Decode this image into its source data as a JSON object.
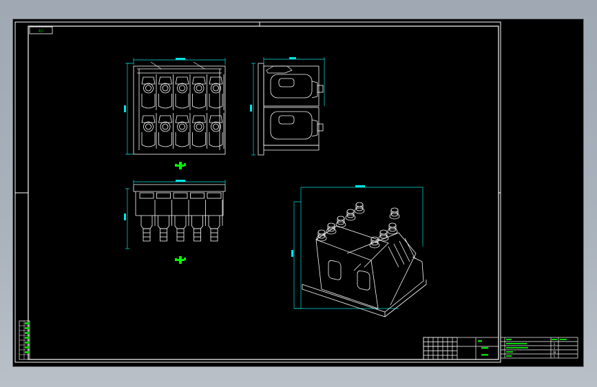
{
  "sheet": {
    "corner_tag": "A3",
    "title_label": "",
    "colors": {
      "border": "#ffffff",
      "geometry": "#ffffff",
      "dimension": "#00e5e5",
      "center_mark": "#00ff00",
      "sidebar_green": "#00d800",
      "viewport_bg": "#000000"
    }
  },
  "title_block": {
    "right_table": {
      "headers": [
        "",
        "",
        "",
        ""
      ],
      "rows": [
        [
          "",
          "",
          "1",
          ""
        ],
        [
          "",
          "",
          "1",
          ""
        ],
        [
          "",
          "",
          "10",
          ""
        ],
        [
          "",
          "",
          "5",
          ""
        ]
      ]
    }
  },
  "icons": {
    "center_mark_top": "crosshair-icon",
    "center_mark_bottom": "crosshair-icon"
  }
}
